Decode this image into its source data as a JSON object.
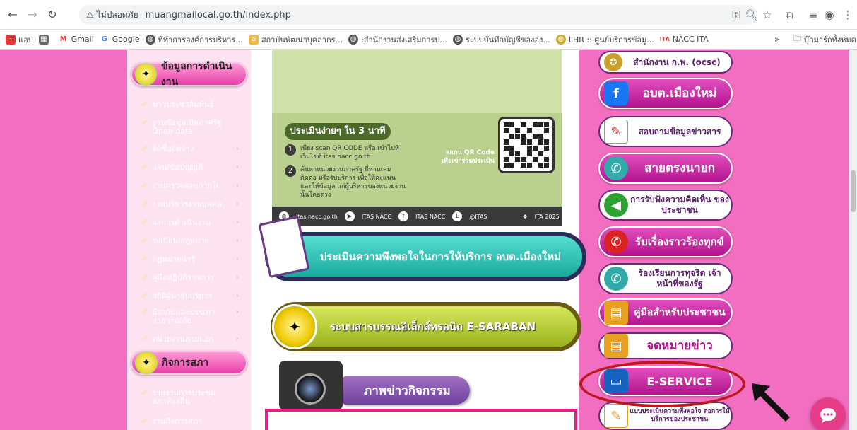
{
  "browser": {
    "security_label": "ไม่ปลอดภัย",
    "url": "muangmailocal.go.th/index.php"
  },
  "bookmarks": [
    {
      "label": "แอป",
      "icon": "apps-icon"
    },
    {
      "label": "Gmail",
      "icon": "gmail-icon"
    },
    {
      "label": "Google",
      "icon": "google-icon"
    },
    {
      "label": "ที่ทำการองค์การบริหาร...",
      "icon": "globe-icon"
    },
    {
      "label": "สถาบันพัฒนาบุคลากร...",
      "icon": "globe-icon"
    },
    {
      "label": ":สำนักงานส่งเสริมการป...",
      "icon": "globe-icon"
    },
    {
      "label": "ระบบบันทึกบัญชีขององ...",
      "icon": "globe-icon"
    },
    {
      "label": "LHR :: ศูนย์บริการข้อมู...",
      "icon": "globe-icon"
    },
    {
      "label": "NACC ITA",
      "icon": "nacc-icon"
    }
  ],
  "bookmarks_all": "บุ๊กมาร์กทั้งหมด",
  "left": {
    "section1": "ข้อมูลการดำเนินงาน",
    "items": [
      "ข่าวประชาสัมพันธ์",
      "ฐานข้อมูลเปิดภาครัฐ Open data",
      "จัดซื้อจัดจ้าง",
      "แผน/ข้อบัญญัติ",
      "งานตรวจสอบภายใน",
      "งานบริหารงานบุคคล",
      "ผลการดำเนินงาน",
      "ระเบียบ/กฎหมาย",
      "กฎหมายน่ารู้",
      "คู่มือปฏิบัติราชการ",
      "สถิติผู้มารับบริการ",
      "ป้องกันและบรรเทา สาธารณภัย",
      "หน่วยงานภายนอก"
    ],
    "section2": "กิจการสภา",
    "items2": [
      "รายงานการประชุม สภาท้องถิ่น",
      "งานกิจการสภา"
    ]
  },
  "banner": {
    "eval_title": "ประเมินง่ายๆ ใน 3 นาที",
    "step1": "เพียง scan QR CODE หรือ เข้าไปที่เว็บไซต์ itas.nacc.go.th",
    "step2": "ค้นหาหน่วยงานภาครัฐ ที่ท่านเคยติดต่อ หรือรับบริการ เพื่อให้คะแนนและให้ข้อมูล แก่ผู้บริหารของหน่วยงานนั้นโดยตรง",
    "scan_text": "สแกน QR Code เพื่อเข้าร่วมประเมิน",
    "footer": [
      "itas.nacc.go.th",
      "ITAS NACC",
      "ITAS NACC",
      "@ITAS",
      "ITA 2025"
    ]
  },
  "center": {
    "survey_btn": "ประเมินความพึงพอใจในการให้บริการ อบต.เมืองใหม่",
    "saraban_btn": "ระบบสารบรรณอิเล็กส์ทรอนิก E-SARABAN",
    "news_title": "ภาพข่าวกิจกรรม"
  },
  "right": {
    "ocsc": "สำนักงาน ก.พ. (ocsc)",
    "facebook": "อบต.เมืองใหม่",
    "inquiry": "สอบถามข้อมูลข่าวสาร",
    "hotline": "สายตรงนายก",
    "opinion": "การรับฟังความคิดเห็น ของประชาชน",
    "complaint": "รับเรื่องราวร้องทุกข์",
    "corruption": "ร้องเรียนการทุจริต เจ้าหน้าที่ของรัฐ",
    "manual": "คู่มือสำหรับประชาชน",
    "newsletter": "จดหมายข่าว",
    "eservice": "E-SERVICE",
    "satisfaction": "แบบประเมินความพึงพอใจ ต่อการให้บริการของประชาชน"
  }
}
